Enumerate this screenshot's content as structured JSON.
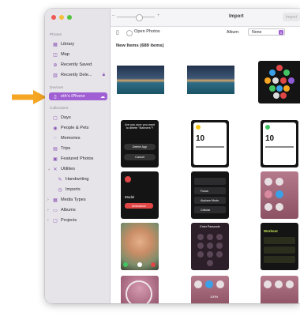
{
  "window": {
    "title": "Import",
    "import_button": "Import"
  },
  "sidebar": {
    "sections": {
      "photos": "Photos",
      "devices": "Devices",
      "collections": "Collections"
    },
    "photos_items": [
      {
        "label": "Library",
        "icon": "photo-library-icon"
      },
      {
        "label": "Map",
        "icon": "map-icon"
      },
      {
        "label": "Recently Saved",
        "icon": "recently-saved-icon"
      },
      {
        "label": "Recently Dele...",
        "icon": "trash-icon"
      }
    ],
    "device_item": {
      "label": "eth's iPhone",
      "icon": "iphone-icon",
      "badge_icon": "cloud-icon"
    },
    "collection_items": [
      {
        "label": "Days",
        "icon": "calendar-icon"
      },
      {
        "label": "People & Pets",
        "icon": "people-icon"
      },
      {
        "label": "Memories",
        "icon": "memories-icon"
      },
      {
        "label": "Trips",
        "icon": "suitcase-icon"
      },
      {
        "label": "Featured Photos",
        "icon": "featured-icon"
      },
      {
        "label": "Utilities",
        "icon": "utilities-icon"
      },
      {
        "label": "Handwriting",
        "icon": "pen-icon"
      },
      {
        "label": "Imports",
        "icon": "imports-icon"
      },
      {
        "label": "Media Types",
        "icon": "media-types-icon"
      },
      {
        "label": "Albums",
        "icon": "albums-icon"
      },
      {
        "label": "Projects",
        "icon": "projects-icon"
      }
    ]
  },
  "subbar": {
    "open_photos": "Open Photos",
    "album_label": "Album:",
    "album_value": "None"
  },
  "grid": {
    "heading": "New Items (689 items)",
    "watch_prompt": "Are you sure you want to delete \"Banners\"?",
    "watch_delete": "Delete App",
    "watch_cancel": "Cancel",
    "clock_time": "10",
    "clock_time2": "10",
    "model_label": "Model",
    "ambulance_label": "Ambulance",
    "focus_label": "Focus",
    "airplane_label": "Airplane Mode",
    "cellular_label": "Cellular",
    "passcode_label": "Enter Passcode",
    "workout_label": "Workout",
    "percent_label": "100%"
  },
  "colors": {
    "accent": "#a05fd3",
    "arrow": "#f5a623"
  }
}
